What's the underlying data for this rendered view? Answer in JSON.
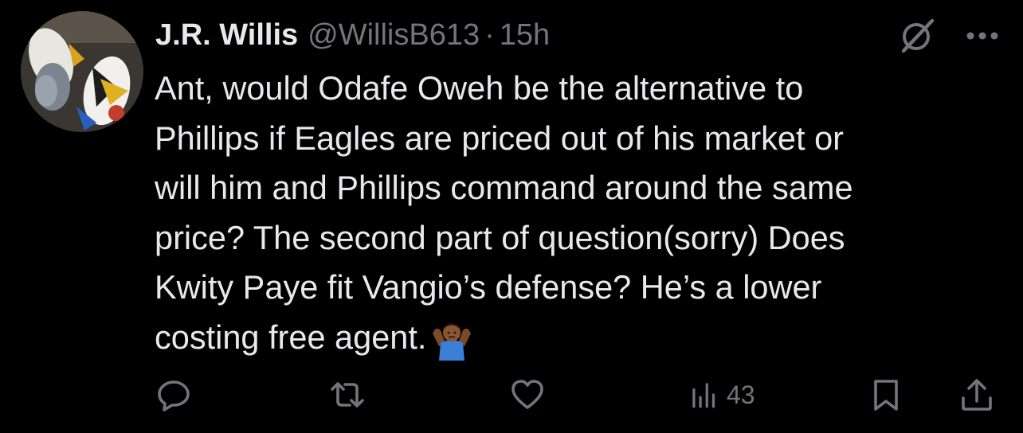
{
  "tweet": {
    "author": {
      "display_name": "J.R. Willis",
      "handle": "@WillisB613",
      "separator": "·",
      "time": "15h"
    },
    "text": "Ant, would Odafe Oweh be the alternative to\nPhillips if Eagles are priced out of his market or\nwill him and Phillips command around the same\nprice? The second part of question(sorry) Does\nKwity Paye fit Vangio’s defense? He’s a lower\ncosting free agent.",
    "emoji": "person-shrugging-emoji",
    "actions": {
      "reply_icon": "reply-icon",
      "retweet_icon": "retweet-icon",
      "like_icon": "like-icon",
      "views_icon": "views-icon",
      "views_count": "43",
      "bookmark_icon": "bookmark-icon",
      "share_icon": "share-icon"
    },
    "header_icons": {
      "grok": "grok-icon",
      "more": "more-icon"
    }
  },
  "colors": {
    "background": "#000000",
    "primary_text": "#e7e9ea",
    "secondary_text": "#71767b"
  }
}
